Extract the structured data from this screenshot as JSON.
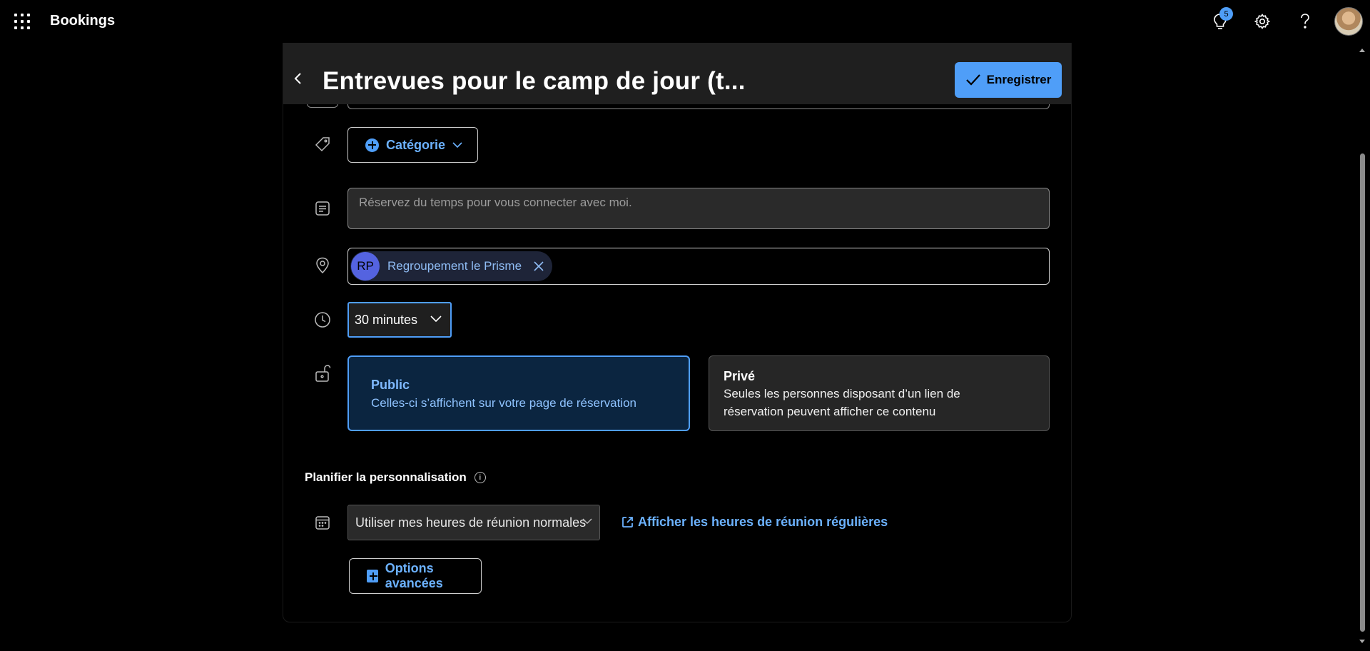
{
  "app": {
    "name": "Bookings"
  },
  "topbar": {
    "notifications_count": "5",
    "icons": [
      "app-launcher-icon",
      "lightbulb-icon",
      "gear-icon",
      "help-icon",
      "user-avatar"
    ]
  },
  "header": {
    "title": "Entrevues pour le camp de jour (t...",
    "save_label": "Enregistrer"
  },
  "form": {
    "category_label": "Catégorie",
    "description_placeholder": "Réservez du temps pour vous connecter avec moi.",
    "location": {
      "initials": "RP",
      "name": "Regroupement le Prisme"
    },
    "duration": "30 minutes",
    "visibility": {
      "public": {
        "title": "Public",
        "description": "Celles-ci s’affichent sur votre page de réservation"
      },
      "private": {
        "title": "Privé",
        "description_line1": "Seules les personnes disposant d’un lien de",
        "description_line2": "réservation peuvent afficher ce contenu"
      },
      "selected": "public"
    },
    "schedule": {
      "section_title": "Planifier la personnalisation",
      "hours_option": "Utiliser mes heures de réunion normales",
      "hours_link": "Afficher les heures de réunion régulières",
      "advanced_label": "Options avancées"
    }
  },
  "colors": {
    "accent": "#4f9ef8",
    "link": "#6cb2ff",
    "background": "#000000",
    "header": "#1f1f1f"
  }
}
